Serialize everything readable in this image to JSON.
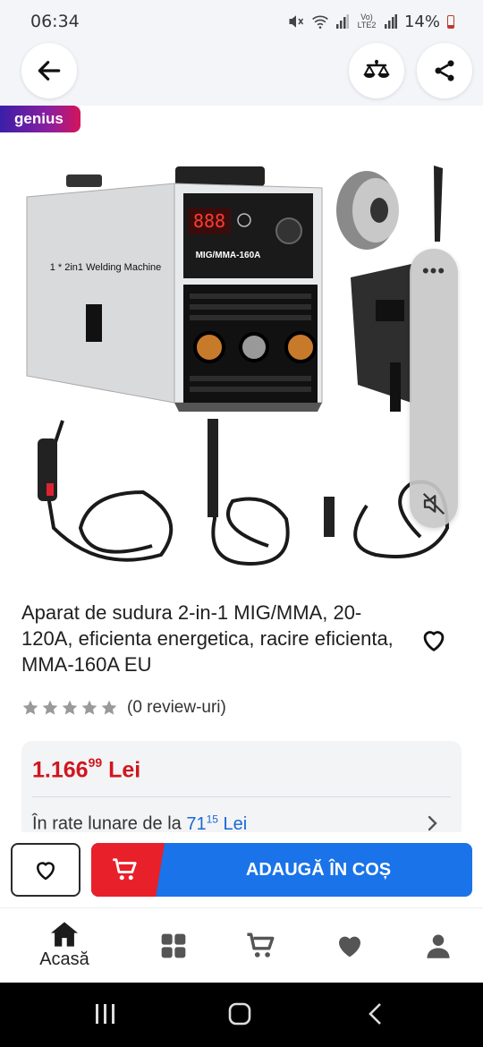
{
  "status_bar": {
    "time": "06:34",
    "icons": [
      "mute-icon",
      "wifi-icon",
      "signal-icon",
      "volte-icon",
      "signal-icon-2"
    ],
    "network_label": "Vo) LTE2",
    "battery": "14%"
  },
  "header": {
    "back_icon": "arrow-left-icon",
    "compare_icon": "scale-balance-icon",
    "share_icon": "share-icon"
  },
  "badge": {
    "label": "genius"
  },
  "product_image": {
    "machine_label": "1 * 2in1 Welding Machine",
    "model_label": "MIG/MMA-160A",
    "display_digits": "888",
    "overlay_icon": "volume-off-icon"
  },
  "product": {
    "title": "Aparat de sudura 2-in-1 MIG/MMA, 20-120A, eficienta energetica, racire eficienta, MMA-160A EU",
    "rating_stars": 0,
    "rating_max": 5,
    "review_count": "(0 review-uri)"
  },
  "price": {
    "integer": "1.166",
    "decimals": "99",
    "currency": "Lei",
    "installment_prefix": "În rate lunare de la",
    "installment_integer": "71",
    "installment_decimals": "15",
    "installment_currency": "Lei"
  },
  "actions": {
    "add_to_cart": "ADAUGĂ ÎN COȘ"
  },
  "bottom_nav": {
    "items": [
      {
        "label": "Acasă",
        "icon": "home-icon",
        "active": true
      },
      {
        "label": "",
        "icon": "categories-icon",
        "active": false
      },
      {
        "label": "",
        "icon": "cart-icon",
        "active": false
      },
      {
        "label": "",
        "icon": "heart-icon",
        "active": false
      },
      {
        "label": "",
        "icon": "user-icon",
        "active": false
      }
    ]
  },
  "colors": {
    "price_red": "#d0161e",
    "accent_blue": "#1a73e8",
    "cart_red": "#e8202a"
  }
}
